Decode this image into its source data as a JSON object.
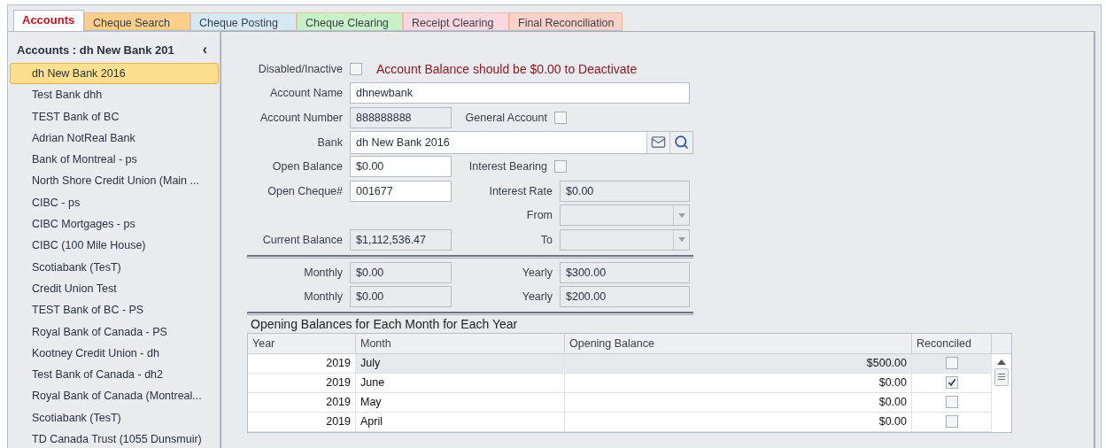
{
  "tabs": [
    {
      "label": "Accounts",
      "selected": true,
      "color": "#ffffff"
    },
    {
      "label": "Cheque Search",
      "selected": false,
      "color": "#fdcf8a"
    },
    {
      "label": "Cheque Posting",
      "selected": false,
      "color": "#d5e9f4"
    },
    {
      "label": "Cheque Clearing",
      "selected": false,
      "color": "#c9f2c9"
    },
    {
      "label": "Receipt Clearing",
      "selected": false,
      "color": "#fbd7e0"
    },
    {
      "label": "Final Reconciliation",
      "selected": false,
      "color": "#fcd1c7"
    }
  ],
  "sidebar": {
    "title": "Accounts :  dh New Bank 201",
    "collapse": "‹",
    "items": [
      {
        "label": "dh New Bank 2016",
        "selected": true
      },
      {
        "label": "Test Bank dhh",
        "selected": false
      },
      {
        "label": "TEST Bank of BC",
        "selected": false
      },
      {
        "label": "Adrian NotReal Bank",
        "selected": false
      },
      {
        "label": "Bank of Montreal - ps",
        "selected": false
      },
      {
        "label": "North Shore Credit Union (Main ...",
        "selected": false
      },
      {
        "label": "CIBC - ps",
        "selected": false
      },
      {
        "label": "CIBC Mortgages - ps",
        "selected": false
      },
      {
        "label": "CIBC (100 Mile House)",
        "selected": false
      },
      {
        "label": "Scotiabank (TesT)",
        "selected": false
      },
      {
        "label": "Credit Union Test",
        "selected": false
      },
      {
        "label": "TEST Bank of BC - PS",
        "selected": false
      },
      {
        "label": "Royal Bank of Canada - PS",
        "selected": false
      },
      {
        "label": "Kootney Credit Union - dh",
        "selected": false
      },
      {
        "label": "Test Bank of Canada - dh2",
        "selected": false
      },
      {
        "label": "Royal Bank of Canada (Montreal...",
        "selected": false
      },
      {
        "label": "Scotiabank (TesT)",
        "selected": false
      },
      {
        "label": "TD Canada Trust (1055 Dunsmuir)",
        "selected": false
      }
    ]
  },
  "form": {
    "disabled": {
      "label": "Disabled/Inactive",
      "checked": false
    },
    "warning": "Account Balance should be $0.00 to Deactivate",
    "account_name": {
      "label": "Account Name",
      "value": "dhnewbank",
      "readonly": false
    },
    "account_number": {
      "label": "Account Number",
      "value": "888888888",
      "readonly": true
    },
    "general_account": {
      "label": "General Account",
      "checked": false
    },
    "bank": {
      "label": "Bank",
      "value": "dh New Bank 2016",
      "readonly": false
    },
    "open_balance": {
      "label": "Open Balance",
      "value": "$0.00",
      "readonly": false
    },
    "interest_bearing": {
      "label": "Interest Bearing",
      "checked": false
    },
    "open_cheque": {
      "label": "Open Cheque#",
      "value": "001677",
      "readonly": false
    },
    "interest_rate": {
      "label": "Interest Rate",
      "value": "$0.00",
      "readonly": true
    },
    "from": {
      "label": "From"
    },
    "to": {
      "label": "To"
    },
    "current_balance": {
      "label": "Current Balance",
      "value": "$1,112,536.47",
      "readonly": true
    },
    "totals": [
      {
        "monthly_label": "Monthly",
        "monthly": "$0.00",
        "yearly_label": "Yearly",
        "yearly": "$300.00"
      },
      {
        "monthly_label": "Monthly",
        "monthly": "$0.00",
        "yearly_label": "Yearly",
        "yearly": "$200.00"
      }
    ]
  },
  "table": {
    "title": "Opening Balances for Each Month for Each Year",
    "columns": [
      "Year",
      "Month",
      "Opening Balance",
      "Reconciled"
    ],
    "rows": [
      {
        "year": "2019",
        "month": "July",
        "opening_balance": "$500.00",
        "reconciled": false,
        "selected": true
      },
      {
        "year": "2019",
        "month": "June",
        "opening_balance": "$0.00",
        "reconciled": true,
        "selected": false
      },
      {
        "year": "2019",
        "month": "May",
        "opening_balance": "$0.00",
        "reconciled": false,
        "selected": false
      },
      {
        "year": "2019",
        "month": "April",
        "opening_balance": "$0.00",
        "reconciled": false,
        "selected": false
      }
    ]
  }
}
